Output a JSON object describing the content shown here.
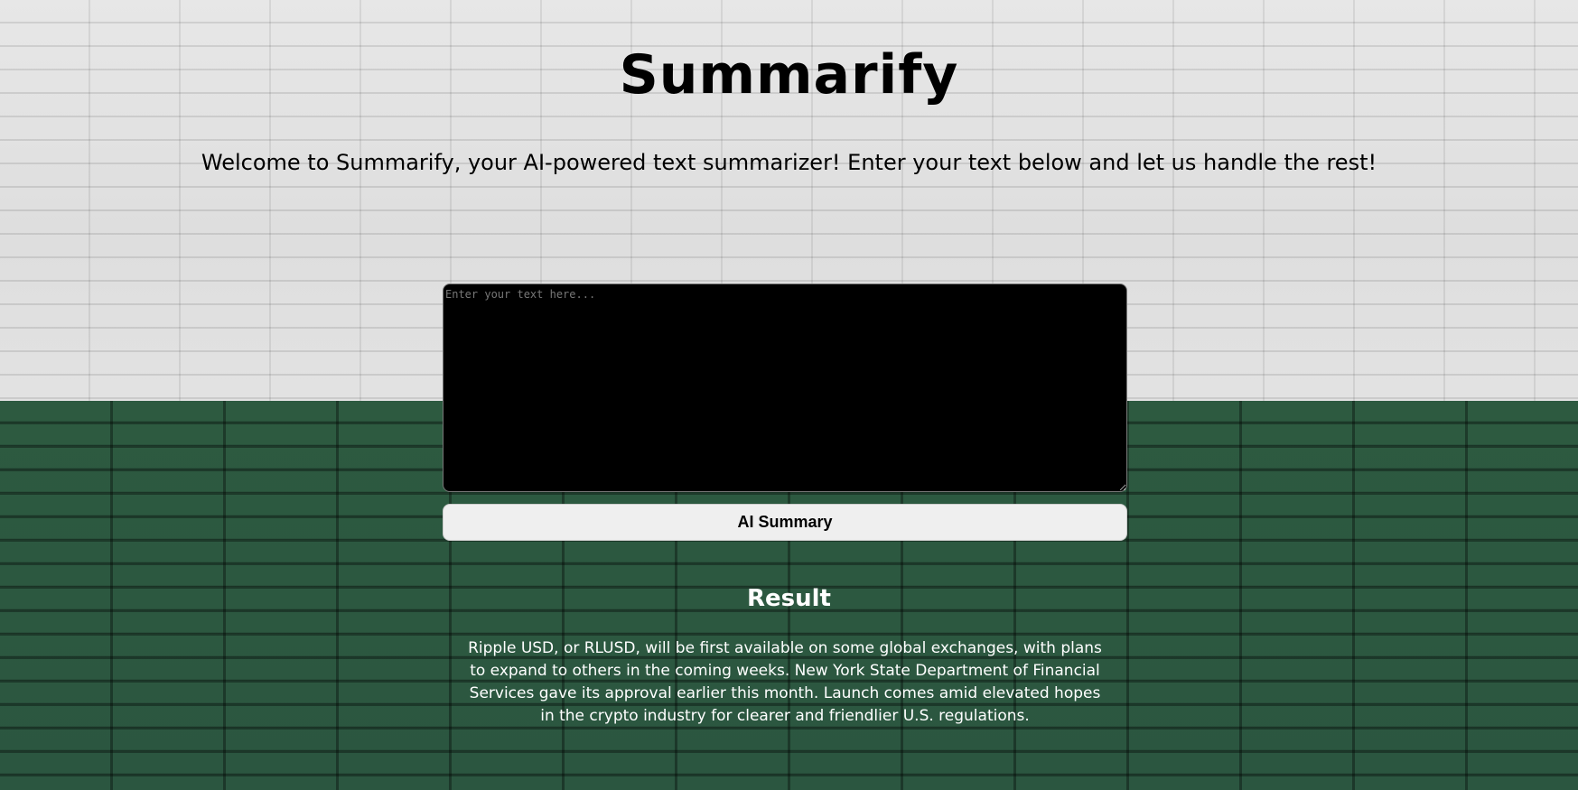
{
  "header": {
    "title": "Summarify",
    "welcome": "Welcome to Summarify, your AI-powered text summarizer! Enter your text below and let us handle the rest!"
  },
  "input": {
    "placeholder": "Enter your text here...",
    "value": ""
  },
  "actions": {
    "summary_label": "AI Summary"
  },
  "result": {
    "heading": "Result",
    "text": "Ripple USD, or RLUSD, will be first available on some global exchanges, with plans to expand to others in the coming weeks. New York State Department of Financial Services gave its approval earlier this month. Launch comes amid elevated hopes in the crypto industry for clearer and friendlier U.S. regulations."
  },
  "colors": {
    "wall_upper": "#e2e2e2",
    "wall_lower": "#2d5a40",
    "textarea_bg": "#000000",
    "button_bg": "#efefef"
  }
}
